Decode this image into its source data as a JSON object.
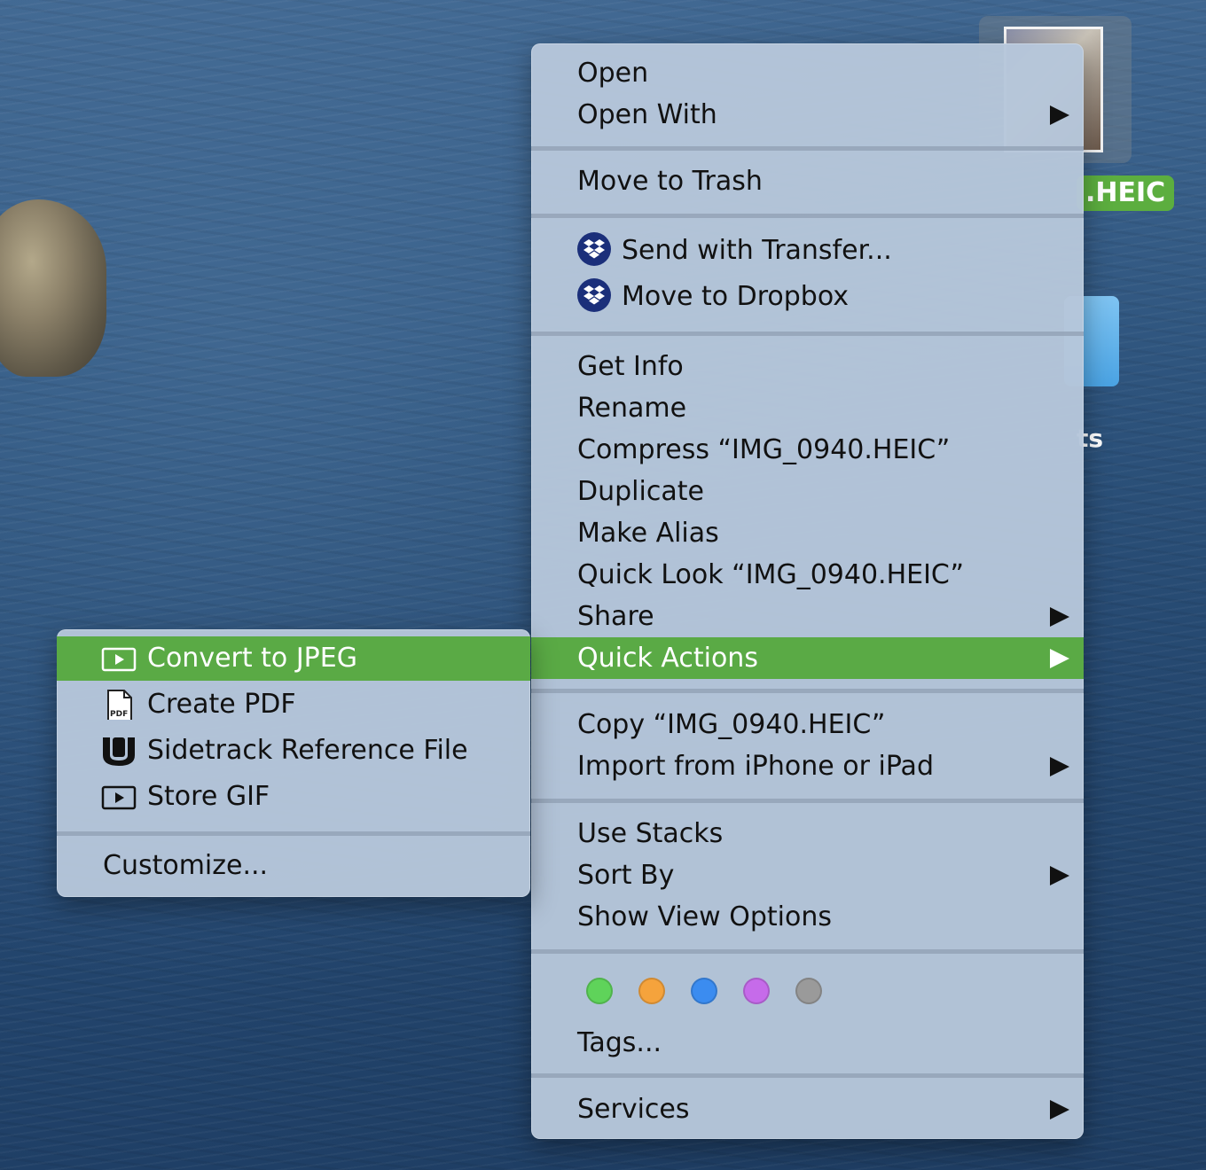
{
  "desktop": {
    "file_label": ".HEIC",
    "folder_label": "ts"
  },
  "main_menu": {
    "open": "Open",
    "open_with": "Open With",
    "move_to_trash": "Move to Trash",
    "send_with_transfer": "Send with Transfer...",
    "move_to_dropbox": "Move to Dropbox",
    "get_info": "Get Info",
    "rename": "Rename",
    "compress": "Compress “IMG_0940.HEIC”",
    "duplicate": "Duplicate",
    "make_alias": "Make Alias",
    "quick_look": "Quick Look “IMG_0940.HEIC”",
    "share": "Share",
    "quick_actions": "Quick Actions",
    "copy": "Copy “IMG_0940.HEIC”",
    "import_from_iphone": "Import from iPhone or iPad",
    "use_stacks": "Use Stacks",
    "sort_by": "Sort By",
    "show_view_options": "Show View Options",
    "tags": "Tags...",
    "services": "Services",
    "tag_colors": [
      "#5fd35a",
      "#f5a33c",
      "#3b8cf0",
      "#c66bea",
      "#9a9a9a"
    ]
  },
  "quick_actions_menu": {
    "convert_to_jpeg": "Convert to JPEG",
    "create_pdf": "Create PDF",
    "sidetrack_reference_file": "Sidetrack Reference File",
    "store_gif": "Store GIF",
    "customize": "Customize..."
  },
  "colors": {
    "highlight": "#5aaa45",
    "menu_bg": "#b6c6da"
  }
}
